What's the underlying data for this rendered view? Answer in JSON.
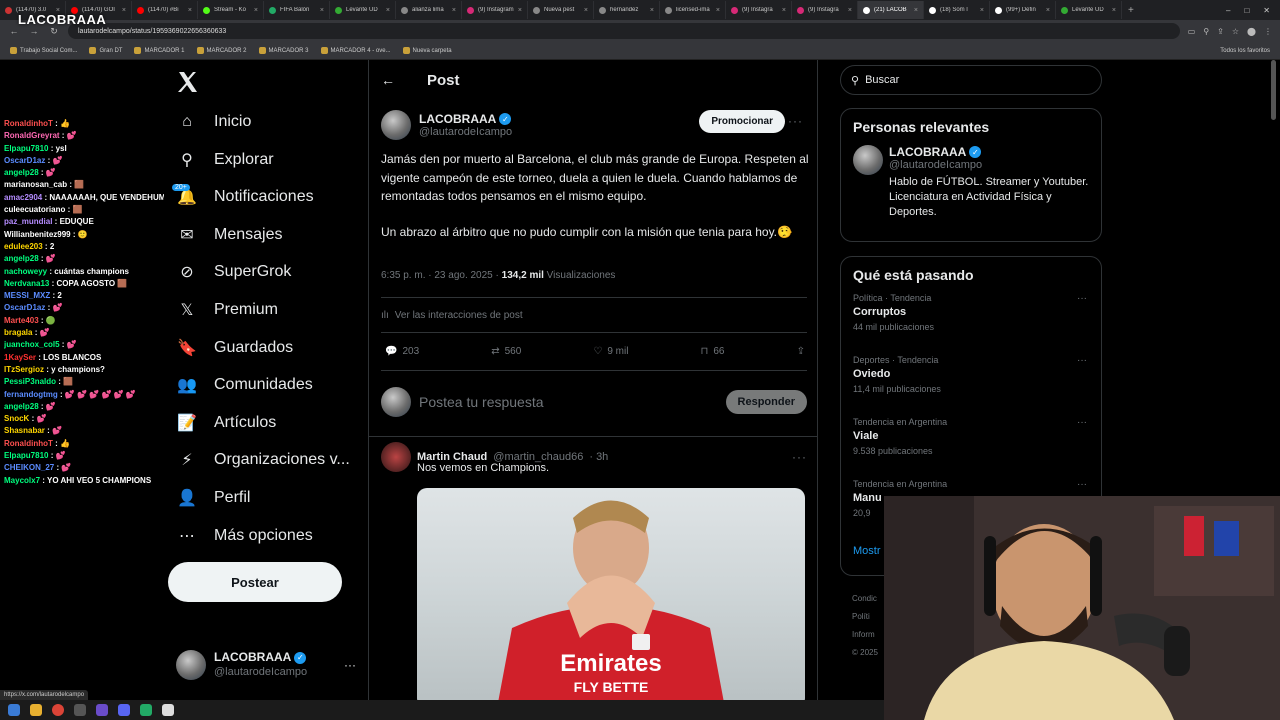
{
  "browser": {
    "tabs": [
      {
        "label": "(11470) 3.0",
        "color": "#c33"
      },
      {
        "label": "(11470) GOI",
        "color": "#f00"
      },
      {
        "label": "(11470) #Bi",
        "color": "#f00"
      },
      {
        "label": "Stream - Ko",
        "color": "#53fc18"
      },
      {
        "label": "FIFA Balón",
        "color": "#2a6"
      },
      {
        "label": "Levante UD",
        "color": "#3a3"
      },
      {
        "label": "alianza lima",
        "color": "#888"
      },
      {
        "label": "(9) Instagram",
        "color": "#d62976"
      },
      {
        "label": "Nueva pest",
        "color": "#888"
      },
      {
        "label": "hernandez",
        "color": "#888"
      },
      {
        "label": "licensed-ima",
        "color": "#888"
      },
      {
        "label": "(9) Instagra",
        "color": "#d62976"
      },
      {
        "label": "(9) Instagra",
        "color": "#d62976"
      },
      {
        "label": "(21) LACOB",
        "color": "#fff",
        "active": true
      },
      {
        "label": "(18) Som l",
        "color": "#fff"
      },
      {
        "label": "(99+) Defin",
        "color": "#fff"
      },
      {
        "label": "Levante UD",
        "color": "#3a3"
      }
    ],
    "url": "lautarodelcampo/status/1959369022656360633",
    "bookmarks": [
      "Trabajo Social Com...",
      "Gran DT",
      "MARCADOR 1",
      "MARCADOR 2",
      "MARCADOR 3",
      "MARCADOR 4 - ove...",
      "Nueva carpeta"
    ],
    "bookmarks_right": "Todos los favoritos",
    "status_link": "https://x.com/lautarodelcampo"
  },
  "stream": {
    "logo": "LACOBRAAA",
    "chat": [
      {
        "user": "RonaldinhoT",
        "text": "👍",
        "color": "#ff5050"
      },
      {
        "user": "RonaldGreyrat",
        "text": "💕",
        "color": "#ff69b4"
      },
      {
        "user": "Elpapu7810",
        "text": "ysl",
        "color": "#00ff7f"
      },
      {
        "user": "OscarD1az",
        "text": "💕",
        "color": "#5b8cff"
      },
      {
        "user": "angelp28",
        "text": "💕",
        "color": "#00ff7f"
      },
      {
        "user": "marianosan_cab",
        "text": "🟫",
        "color": "#ffffff"
      },
      {
        "user": "amac2904",
        "text": "NAAAAAAH, QUE VENDEHUMO JAJADSJSDLÑKSD",
        "color": "#b58cff"
      },
      {
        "user": "culeecuatoriano",
        "text": "🟫",
        "color": "#ffffff"
      },
      {
        "user": "paz_mundial",
        "text": "EDUQUE",
        "color": "#b58cff"
      },
      {
        "user": "Willianbenitez999",
        "text": "🙂",
        "color": "#ffffff"
      },
      {
        "user": "edulee203",
        "text": "2",
        "color": "#ffd700"
      },
      {
        "user": "angelp28",
        "text": "💕",
        "color": "#00ff7f"
      },
      {
        "user": "nachoweyy",
        "text": "cuántas champions",
        "color": "#00ff7f"
      },
      {
        "user": "Nerdvana13",
        "text": "COPA AGOSTO 🟫",
        "color": "#00ff7f"
      },
      {
        "user": "MESSI_MXZ",
        "text": "2",
        "color": "#5b8cff"
      },
      {
        "user": "OscarD1az",
        "text": "💕",
        "color": "#5b8cff"
      },
      {
        "user": "Marte403",
        "text": "🟢",
        "color": "#ff5050"
      },
      {
        "user": "bragala",
        "text": "💕",
        "color": "#ffd700"
      },
      {
        "user": "juanchox_col5",
        "text": "💕",
        "color": "#00ff7f"
      },
      {
        "user": "1KaySer",
        "text": "LOS BLANCOS",
        "color": "#ff3030"
      },
      {
        "user": "ITzSergioz",
        "text": "y champions?",
        "color": "#ffd700"
      },
      {
        "user": "PessiP3naldo",
        "text": "🟫",
        "color": "#00ff7f"
      },
      {
        "user": "fernandogtmg",
        "text": "💕 💕 💕 💕 💕 💕",
        "color": "#5b8cff"
      },
      {
        "user": "angelp28",
        "text": "💕",
        "color": "#00ff7f"
      },
      {
        "user": "SnocK",
        "text": "💕",
        "color": "#ffd700"
      },
      {
        "user": "Shasnabar",
        "text": "💕",
        "color": "#ffd700"
      },
      {
        "user": "RonaldinhoT",
        "text": "👍",
        "color": "#ff5050"
      },
      {
        "user": "Elpapu7810",
        "text": "💕",
        "color": "#00ff7f"
      },
      {
        "user": "CHEIKON_27",
        "text": "💕",
        "color": "#5b8cff"
      },
      {
        "user": "Maycolx7",
        "text": "YO AHI VEO 5 CHAMPIONS",
        "color": "#00ff7f"
      }
    ]
  },
  "nav": {
    "items": [
      {
        "label": "Inicio",
        "icon": "home-icon",
        "glyph": "⌂"
      },
      {
        "label": "Explorar",
        "icon": "search-icon",
        "glyph": "⚲"
      },
      {
        "label": "Notificaciones",
        "icon": "bell-icon",
        "glyph": "🔔"
      },
      {
        "label": "Mensajes",
        "icon": "mail-icon",
        "glyph": "✉"
      },
      {
        "label": "SuperGrok",
        "icon": "grok-icon",
        "glyph": "⊘"
      },
      {
        "label": "Premium",
        "icon": "x-premium-icon",
        "glyph": "𝕏"
      },
      {
        "label": "Guardados",
        "icon": "bookmark-icon",
        "glyph": "🔖"
      },
      {
        "label": "Comunidades",
        "icon": "communities-icon",
        "glyph": "👥"
      },
      {
        "label": "Artículos",
        "icon": "articles-icon",
        "glyph": "📝"
      },
      {
        "label": "Organizaciones v...",
        "icon": "lightning-icon",
        "glyph": "⚡"
      },
      {
        "label": "Perfil",
        "icon": "profile-icon",
        "glyph": "👤"
      },
      {
        "label": "Más opciones",
        "icon": "more-options-icon",
        "glyph": "⋯"
      }
    ],
    "notif_badge": "20+",
    "post_button": "Postear",
    "account_name": "LACOBRAAA",
    "account_handle": "@lautarodeIcampo"
  },
  "post": {
    "header_title": "Post",
    "author_name": "LACOBRAAA",
    "author_handle": "@lautarodeIcampo",
    "promote_label": "Promocionar",
    "text_p1": "Jamás den por muerto al Barcelona, el club más grande de Europa. Respeten al vigente campeón de este torneo, duela a quien le duela. Cuando hablamos de remontadas todos pensamos en el mismo equipo.",
    "text_p2": "Un abrazo al árbitro que no pudo cumplir con la misión que tenia para hoy.🤥",
    "time": "6:35 p. m. · 23 ago. 2025 · ",
    "views_count": "134,2 mil",
    "views_label": " Visualizaciones",
    "interactions_label": "Ver las interacciones de post",
    "replies": "203",
    "reposts": "560",
    "likes": "9 mil",
    "bookmarks": "66",
    "reply_placeholder": "Postea tu respuesta",
    "reply_button": "Responder"
  },
  "reply_tweet": {
    "name": "Martin Chaud",
    "handle": "@martin_chaud66",
    "time": "· 3h",
    "text": "Nos vemos en Champions.",
    "image_jersey_text": "Emirates",
    "image_jersey_text2": "FLY BETTE"
  },
  "sidebar": {
    "search_placeholder": "Buscar",
    "relevant_title": "Personas relevantes",
    "relevant_name": "LACOBRAAA",
    "relevant_handle": "@lautarodeIcampo",
    "relevant_bio": "Hablo de FÚTBOL. Streamer y Youtuber. Licenciatura en Actividad Física y Deportes.",
    "trends_title": "Qué está pasando",
    "trends": [
      {
        "category": "Política · Tendencia",
        "title": "Corruptos",
        "count": "44 mil publicaciones"
      },
      {
        "category": "Deportes · Tendencia",
        "title": "Oviedo",
        "count": "11,4 mil publicaciones"
      },
      {
        "category": "Tendencia en Argentina",
        "title": "Viale",
        "count": "9.538 publicaciones"
      },
      {
        "category": "Tendencia en Argentina",
        "title": "Manu",
        "count": "20,9"
      }
    ],
    "show_more": "Mostr",
    "footer": [
      "Condic",
      "Políti",
      "Inform",
      "© 2025"
    ]
  },
  "colors": {
    "accent": "#1d9bf0",
    "background": "#000000",
    "text": "#e7e9ea",
    "muted": "#71767b",
    "border": "#2f3336"
  }
}
